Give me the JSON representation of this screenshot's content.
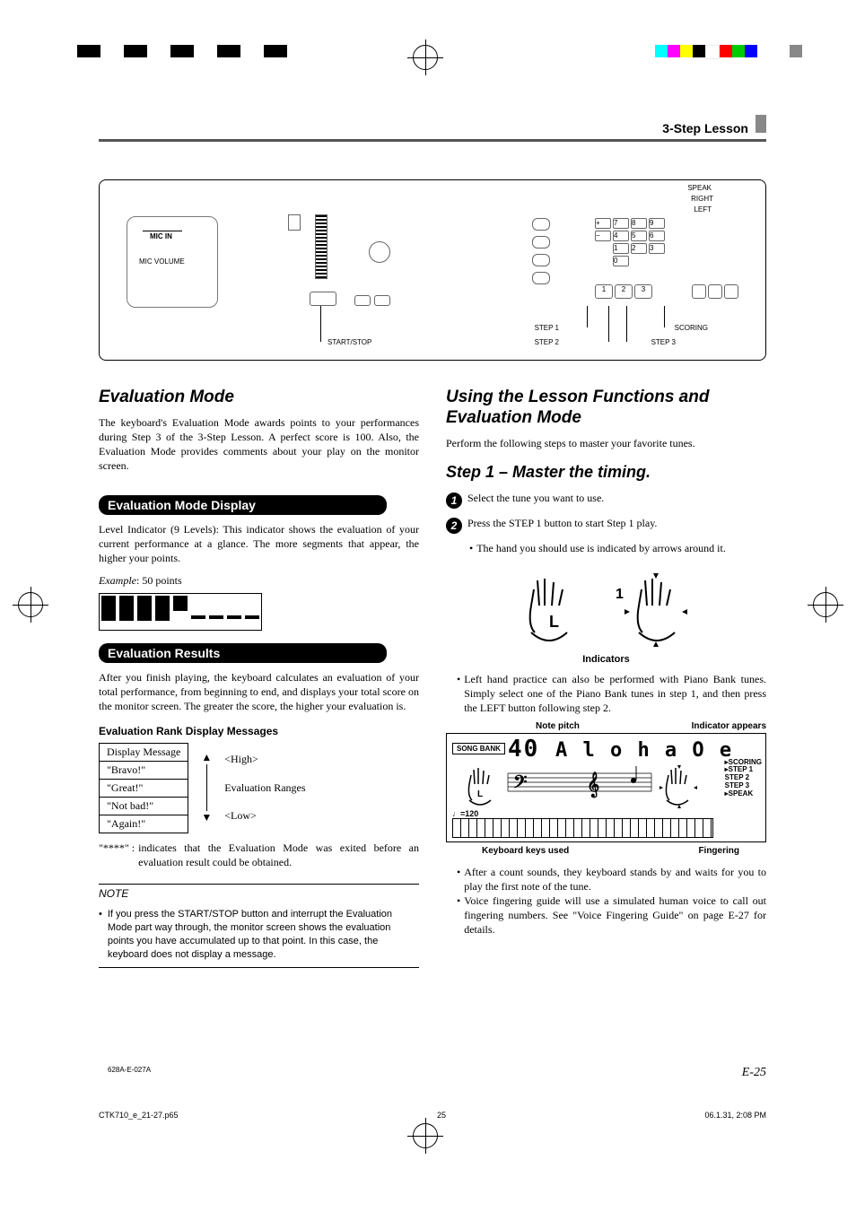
{
  "header": {
    "title": "3-Step Lesson"
  },
  "diagram_labels": {
    "speak": "SPEAK",
    "right": "RIGHT",
    "left": "LEFT",
    "step1": "STEP 1",
    "step2": "STEP 2",
    "step3": "STEP 3",
    "scoring": "SCORING",
    "start_stop": "START/STOP",
    "mic_in": "MIC IN",
    "mic_volume": "MIC VOLUME"
  },
  "left": {
    "eval_mode_title": "Evaluation Mode",
    "eval_mode_body": "The keyboard's Evaluation Mode awards points to your performances during Step 3 of the 3-Step Lesson. A perfect score is 100. Also, the Evaluation Mode provides comments about your play on the monitor screen.",
    "tab1": "Evaluation Mode Display",
    "tab1_body": "Level Indicator (9 Levels): This indicator shows the evaluation of your current performance at a glance. The more segments that appear, the higher your points.",
    "example_label": "Example",
    "example_value": ":  50 points",
    "tab2": "Evaluation Results",
    "tab2_body": "After you finish playing, the keyboard calculates an evaluation of your total performance, from beginning to end, and displays your total score on the monitor screen. The greater the score, the higher your evaluation is.",
    "rank_title": "Evaluation Rank Display Messages",
    "rank_table": {
      "header": "Display Message",
      "rows": [
        "\"Bravo!\"",
        "\"Great!\"",
        "\"Not bad!\"",
        "\"Again!\""
      ]
    },
    "rank_arrow": {
      "high": "<High>",
      "mid": "Evaluation Ranges",
      "low": "<Low>"
    },
    "exit_sym": "\"****\" :",
    "exit_text": "indicates that the Evaluation Mode was exited before an evaluation result could be obtained.",
    "note_label": "NOTE",
    "note_body": "If you press the START/STOP button and interrupt the Evaluation Mode part way through, the monitor screen shows the evaluation points you have accumulated up to that point. In this case, the keyboard does not display a message."
  },
  "right": {
    "title": "Using the Lesson Functions and Evaluation Mode",
    "intro": "Perform the following steps to master your favorite tunes.",
    "step_title": "Step 1 – Master the timing.",
    "s1": "Select the tune you want to use.",
    "s2": "Press the STEP 1 button to start Step 1 play.",
    "s2b": "The hand you should use is indicated by arrows around it.",
    "indicators_cap": "Indicators",
    "bullet_piano": "Left hand practice can also be performed with Piano Bank tunes. Simply select one of the Piano Bank tunes in step 1, and then press the LEFT button following step 2.",
    "lcd_caps": {
      "note_pitch": "Note pitch",
      "indicator_appears": "Indicator appears",
      "keyboard_keys": "Keyboard keys used",
      "fingering": "Fingering"
    },
    "lcd_text": {
      "song_bank": "SONG BANK",
      "title": "A l o h a  O e",
      "num": "40",
      "scoring": "SCORING",
      "step1": "STEP 1",
      "step2": "STEP 2",
      "step3": "STEP 3",
      "speak": "SPEAK",
      "tempo": "120"
    },
    "bullet_after": "After a count sounds, they keyboard stands by and waits for you to play the first note of the tune.",
    "bullet_voice": "Voice fingering guide will use a simulated human voice to call out fingering numbers. See \"Voice Fingering Guide\" on page E-27 for details."
  },
  "footer": {
    "page": "E-25",
    "code": "628A-E-027A",
    "file": "CTK710_e_21-27.p65",
    "pg": "25",
    "ts": "06.1.31, 2:08 PM"
  }
}
